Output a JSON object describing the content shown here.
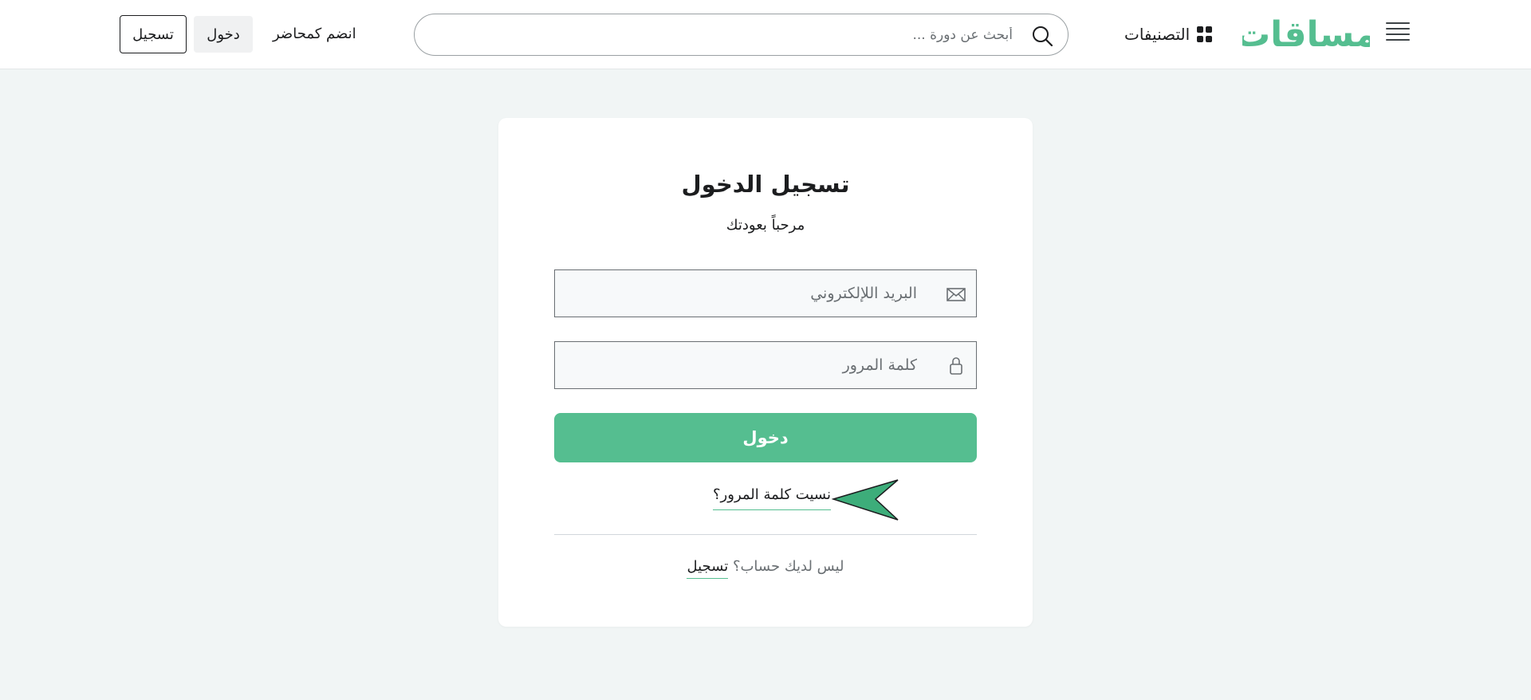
{
  "header": {
    "logo_text": "مساقات",
    "categories_label": "التصنيفات",
    "search_placeholder": "أبحث عن دورة ...",
    "instructor_label": "انضم كمحاضر",
    "login_label": "دخول",
    "register_label": "تسجيل"
  },
  "login": {
    "title": "تسجيل الدخول",
    "subtitle": "مرحباً بعودتك",
    "email_placeholder": "البريد اللإلكتروني",
    "password_placeholder": "كلمة المرور",
    "submit_label": "دخول",
    "forgot_label": "نسيت كلمة المرور؟",
    "no_account_text": "ليس لديك حساب؟",
    "signup_label": "تسجيل"
  },
  "colors": {
    "brand": "#55be90",
    "background": "#f1f5f5",
    "text": "#1c1d1f"
  },
  "icons": [
    "menu-icon",
    "grid-icon",
    "search-icon",
    "envelope-icon",
    "lock-icon",
    "arrow-pointer-icon"
  ]
}
